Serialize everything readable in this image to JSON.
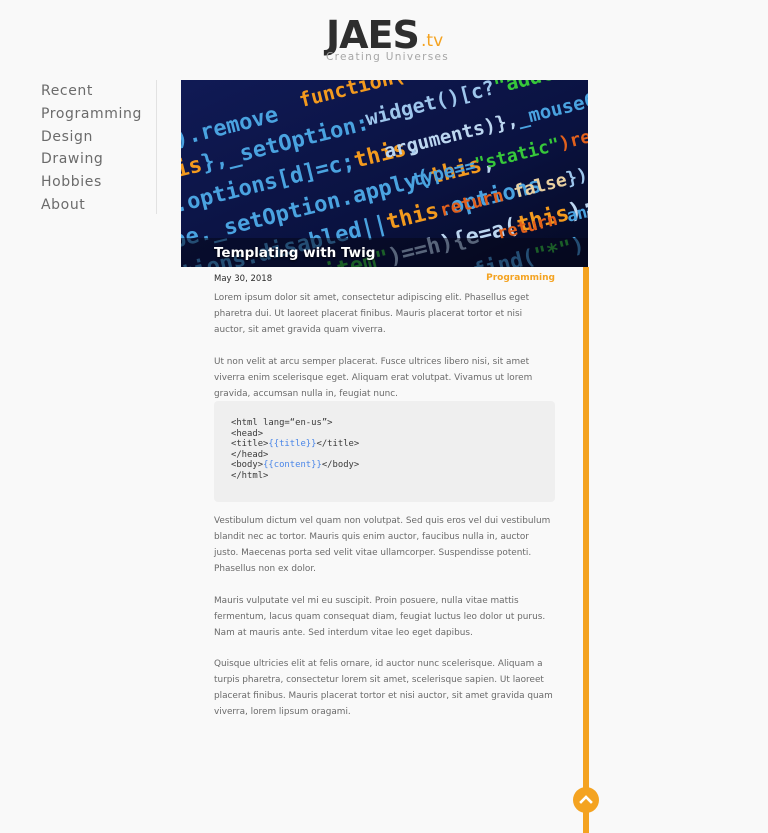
{
  "logo": {
    "main": "JAES",
    "suffix": ".tv",
    "tagline": "Creating Universes"
  },
  "sidebar": {
    "items": [
      {
        "label": "Recent"
      },
      {
        "label": "Programming"
      },
      {
        "label": "Design"
      },
      {
        "label": "Drawing"
      },
      {
        "label": "Hobbies"
      },
      {
        "label": "About"
      }
    ]
  },
  "post": {
    "title": "Templating with Twig",
    "hero_icon": "code-screen-image",
    "date": "May 30, 2018",
    "category": "Programming",
    "paragraphs": [
      "Lorem ipsum dolor sit amet, consectetur adipiscing elit. Phasellus eget pharetra dui. Ut laoreet placerat finibus. Mauris placerat tortor et nisi auctor, sit amet gravida quam viverra.",
      "Ut non velit at arcu semper placerat. Fusce ultrices libero nisi, sit amet viverra enim scelerisque eget. Aliquam erat volutpat. Vivamus ut lorem gravida, accumsan nulla in, feugiat nunc.",
      "Vestibulum dictum vel quam non volutpat. Sed quis eros vel dui vestibulum blandit nec ac tortor. Mauris quis enim auctor, faucibus nulla in, auctor justo. Maecenas porta sed velit vitae ullamcorper. Suspendisse potenti. Phasellus non ex dolor.",
      "Mauris vulputate vel mi eu suscipit. Proin posuere, nulla vitae mattis fermentum, lacus quam consequat diam, feugiat luctus leo dolor ut purus. Nam at mauris ante. Sed interdum vitae leo eget dapibus.",
      "Quisque ultricies elit at felis ornare, id auctor nunc scelerisque. Aliquam a turpis pharetra, consectetur lorem sit amet, scelerisque sapien. Ut laoreet placerat finibus. Mauris placerat tortor et nisi auctor, sit amet gravida quam viverra, lorem lipsum oragami."
    ],
    "code": {
      "line1": "<html lang=“en-us”>",
      "line2": "<head>",
      "line3_open": "<title>",
      "line3_var": "{{title}}",
      "line3_close": "</title>",
      "line4": "</head>",
      "line5_open": "<body>",
      "line5_var": "{{content}}",
      "line5_close": "</body>",
      "line6": "</html>"
    }
  },
  "controls": {
    "scroll_top_icon": "chevron-up-icon"
  },
  "colors": {
    "accent": "#f4a321",
    "background": "#f9f9f9",
    "code_background": "#efefef",
    "code_variable": "#4a86e8"
  }
}
